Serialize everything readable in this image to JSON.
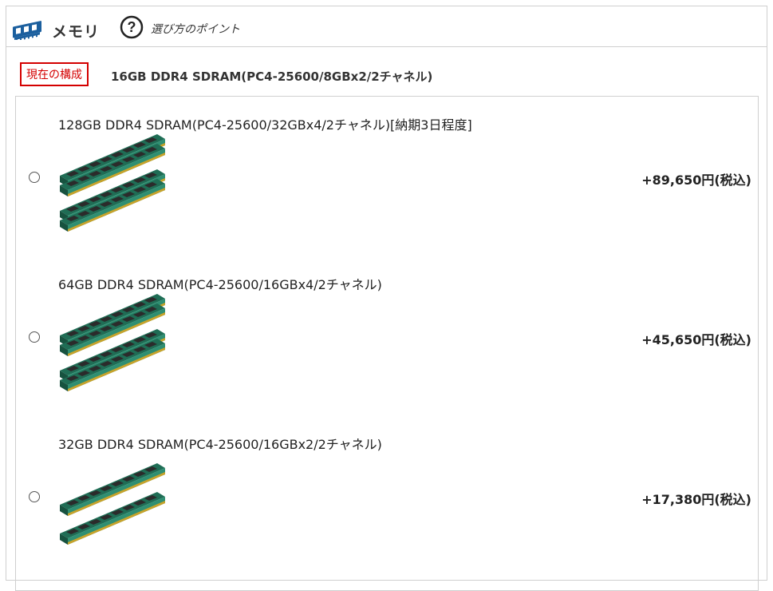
{
  "header": {
    "title": "メモリ",
    "help_label": "選び方のポイント"
  },
  "current": {
    "badge": "現在の構成",
    "value": "16GB DDR4 SDRAM(PC4-25600/8GBx2/2チャネル)"
  },
  "options": [
    {
      "title": "128GB DDR4 SDRAM(PC4-25600/32GBx4/2チャネル)[納期3日程度]",
      "price": "+89,650円(税込)",
      "selected": false,
      "module_count": 4
    },
    {
      "title": "64GB DDR4 SDRAM(PC4-25600/16GBx4/2チャネル)",
      "price": "+45,650円(税込)",
      "selected": false,
      "module_count": 4
    },
    {
      "title": "32GB DDR4 SDRAM(PC4-25600/16GBx2/2チャネル)",
      "price": "+17,380円(税込)",
      "selected": false,
      "module_count": 2
    }
  ],
  "colors": {
    "badge_red": "#d40000",
    "pcb_green": "#2f8f72",
    "contact_gold": "#c9a32a",
    "chip_dark": "#2b2b2b",
    "icon_blue": "#1b5f9e"
  }
}
